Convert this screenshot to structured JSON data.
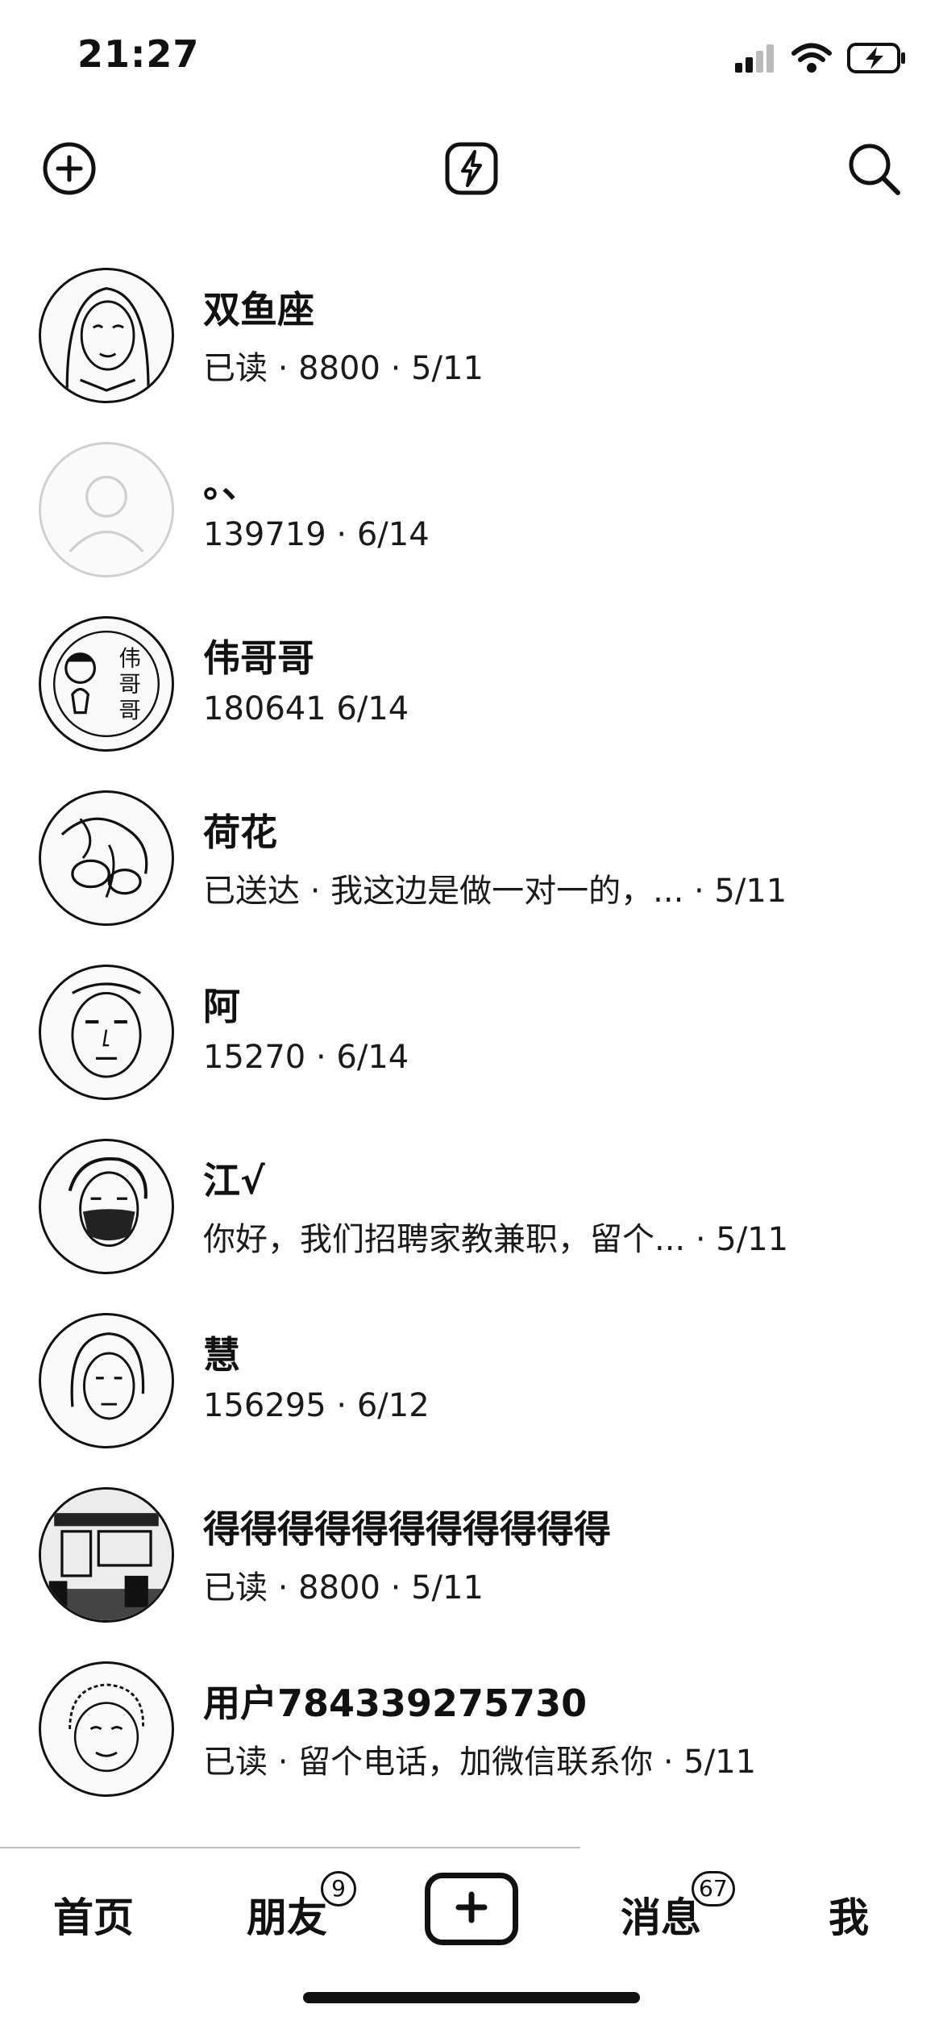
{
  "status_bar": {
    "time": "21:27"
  },
  "top_bar": {
    "icons": [
      "plus-circle-icon",
      "lightning-icon",
      "search-icon"
    ]
  },
  "conversations": [
    {
      "name": "双鱼座",
      "subtitle": "已读 · 8800 · 5/11",
      "avatar": "portrait-woman"
    },
    {
      "name": "。、",
      "subtitle": "139719 · 6/14",
      "avatar": "default-user"
    },
    {
      "name": "伟哥哥",
      "subtitle": "180641 6/14",
      "avatar": "stamp-text"
    },
    {
      "name": "荷花",
      "subtitle": "已送达 · 我这边是做一对一的，... · 5/11",
      "avatar": "lotus-drawing"
    },
    {
      "name": "阿",
      "subtitle": "15270 · 6/14",
      "avatar": "portrait-man"
    },
    {
      "name": "江√",
      "subtitle": "你好，我们招聘家教兼职，留个... · 5/11",
      "avatar": "portrait-mask"
    },
    {
      "name": "慧",
      "subtitle": "156295 · 6/12",
      "avatar": "portrait-woman-2"
    },
    {
      "name": "得得得得得得得得得得得",
      "subtitle": "已读 · 8800 · 5/11",
      "avatar": "street-scene"
    },
    {
      "name": "用户784339275730",
      "subtitle": "已读 · 留个电话，加微信联系你 · 5/11",
      "avatar": "portrait-child"
    }
  ],
  "tab_bar": {
    "home": "首页",
    "friends": "朋友",
    "friends_badge": "9",
    "messages": "消息",
    "messages_badge": "67",
    "me": "我"
  }
}
